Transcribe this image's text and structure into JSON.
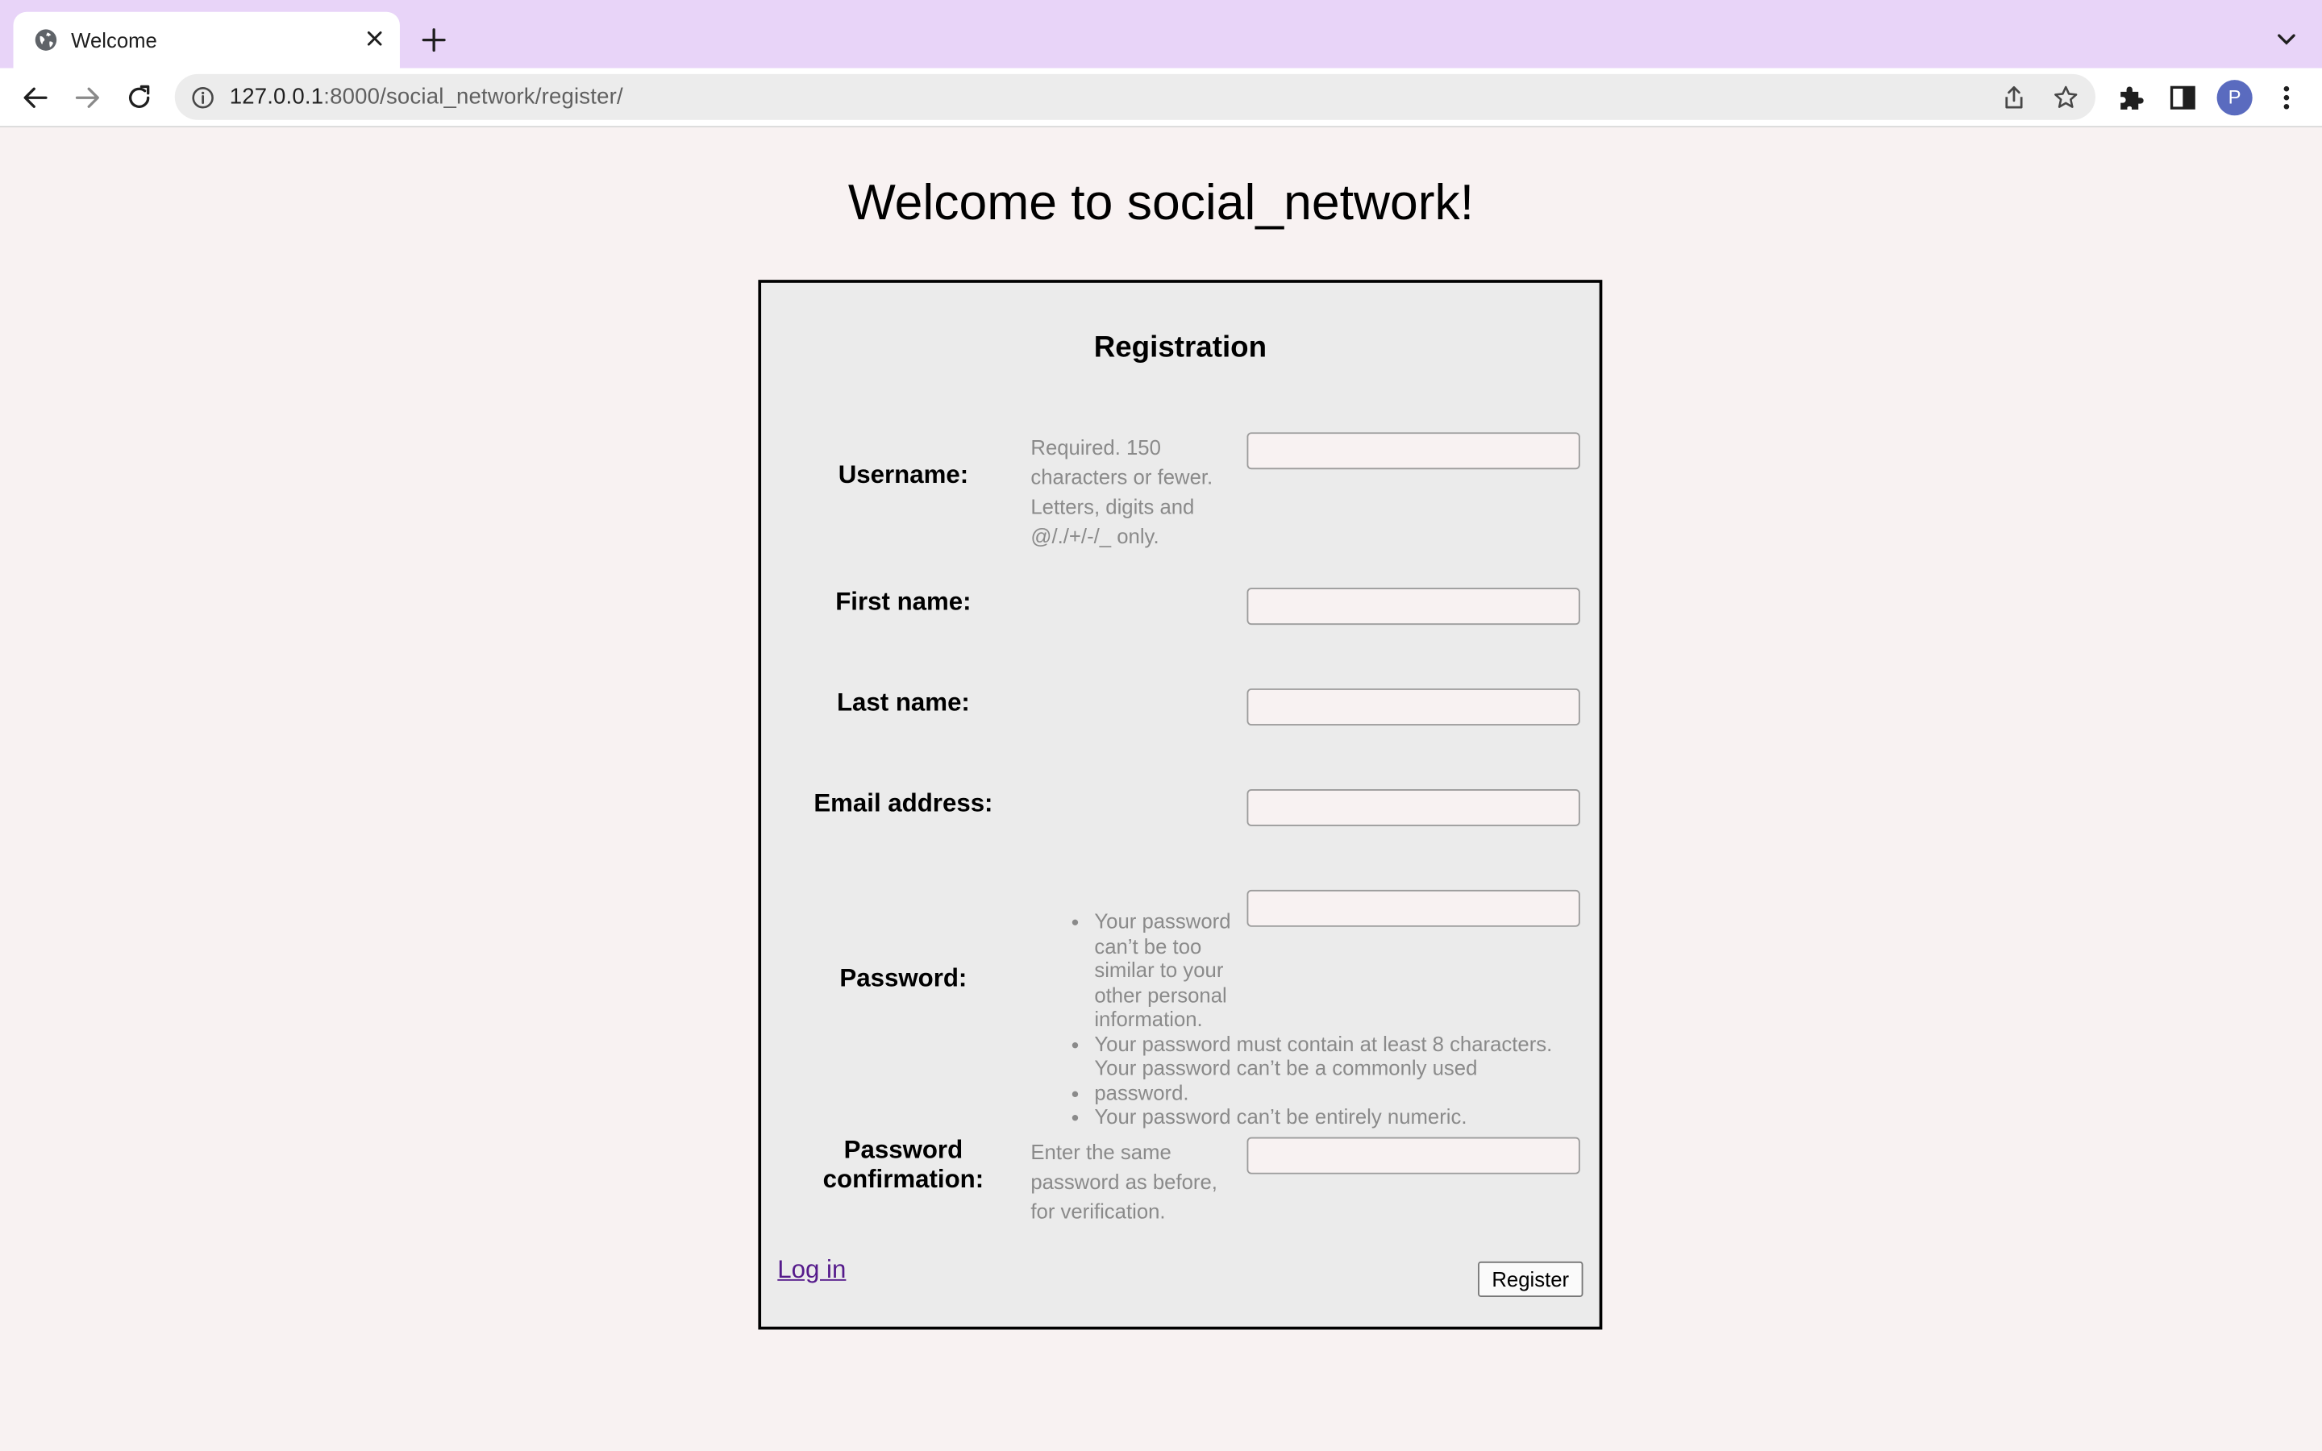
{
  "browser": {
    "tab": {
      "title": "Welcome"
    },
    "address_bar": {
      "host": "127.0.0.1",
      "rest": ":8000/social_network/register/"
    },
    "profile_initial": "P"
  },
  "page": {
    "title": "Welcome to social_network!"
  },
  "form": {
    "heading": "Registration",
    "username": {
      "label": "Username:",
      "help": "Required. 150 characters or fewer. Letters, digits and @/./+/-/_ only.",
      "value": ""
    },
    "first_name": {
      "label": "First name:",
      "value": ""
    },
    "last_name": {
      "label": "Last name:",
      "value": ""
    },
    "email": {
      "label": "Email address:",
      "value": ""
    },
    "password": {
      "label": "Password:",
      "value": "",
      "rules": [
        "Your password can’t be too similar to your other personal information.",
        "Your password must contain at least 8 characters.",
        "Your password can’t be a commonly used password.",
        "Your password can’t be entirely numeric."
      ]
    },
    "password_confirmation": {
      "label_line1": "Password",
      "label_line2": "confirmation:",
      "help": "Enter the same password as before, for verification.",
      "value": ""
    },
    "login_link": "Log in",
    "submit": "Register"
  }
}
